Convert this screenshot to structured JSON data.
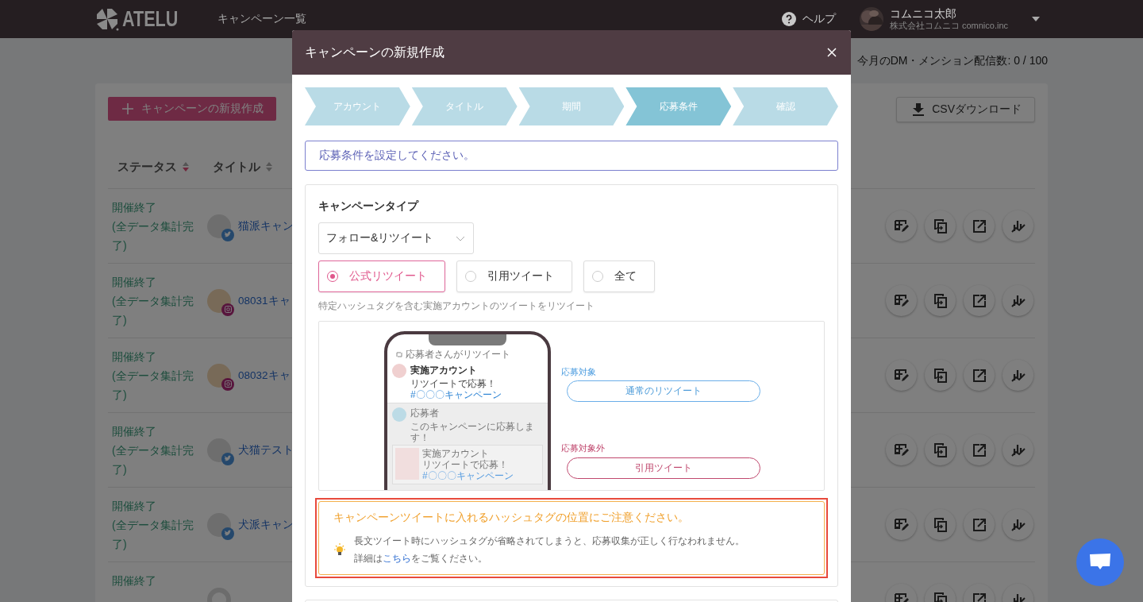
{
  "header": {
    "logo": "ATELU",
    "nav": [
      {
        "label": "キャンペーン一覧"
      }
    ],
    "help": "ヘルプ",
    "user": {
      "name": "コムニコ太郎",
      "company": "株式会社コムニコ comnico.inc"
    }
  },
  "quota": "今月のDM・メンション配信数: 0 / 100",
  "toolbar": {
    "new_button": "キャンペーンの新規作成",
    "csv_button": "CSVダウンロード"
  },
  "table": {
    "columns": [
      {
        "label": "ステータス",
        "sorted": true
      },
      {
        "label": "タイトル",
        "sorted": false
      }
    ],
    "rows": [
      {
        "status": "開催終了",
        "status_detail": "(全データ集計完了)",
        "kind": "twitter",
        "title": "猫派キャン"
      },
      {
        "status": "開催終了",
        "status_detail": "(全データ集計完了)",
        "kind": "instagram",
        "title": "08031キャ"
      },
      {
        "status": "開催終了",
        "status_detail": "(全データ集計完了)",
        "kind": "instagram",
        "title": "08032キャ"
      },
      {
        "status": "開催終了",
        "status_detail": "(全データ集計完了)",
        "kind": "twitter",
        "title": "犬猫テスト"
      },
      {
        "status": "開催終了",
        "status_detail": "(全データ集計完了)",
        "kind": "twitter",
        "title": "犬派キャン"
      },
      {
        "status": "開催終了",
        "kind": "none"
      }
    ]
  },
  "modal": {
    "title": "キャンペーンの新規作成",
    "steps": [
      {
        "label": "アカウント",
        "selected": false
      },
      {
        "label": "タイトル",
        "selected": false
      },
      {
        "label": "期間",
        "selected": false
      },
      {
        "label": "応募条件",
        "selected": true
      },
      {
        "label": "確認",
        "selected": false
      }
    ],
    "instruction": "応募条件を設定してください。",
    "campaign_type": {
      "label": "キャンペーンタイプ",
      "select_value": "フォロー&リツイート",
      "options": [
        {
          "label": "公式リツイート",
          "selected": true
        },
        {
          "label": "引用ツイート",
          "selected": false
        },
        {
          "label": "全て",
          "selected": false
        }
      ],
      "description": "特定ハッシュタグを含む実施アカウントのツイートをリツイート"
    },
    "illustration": {
      "caption": "応募者さんがリツイート",
      "account": "実施アカウント",
      "tweet": "リツイートで応募！",
      "hashtag": "#〇〇〇キャンペーン",
      "applicant": "応募者",
      "reply": "このキャンペーンに応募します！",
      "quoted_account": "実施アカウント",
      "quoted_tweet": "リツイートで応募！",
      "quoted_hashtag": "#〇〇〇キャンペーン",
      "eligible_label": "応募対象",
      "eligible": "通常のリツイート",
      "ineligible_label": "応募対象外",
      "ineligible": "引用ツイート"
    },
    "notice": {
      "title": "キャンペーンツイートに入れるハッシュタグの位置にご注意ください。",
      "text": "長文ツイート時にハッシュタグが省略されてしまうと、応募収集が正しく行なわれません。",
      "detail_before": "詳細は",
      "link": "こちら",
      "detail_after": "をご覧ください。"
    }
  }
}
